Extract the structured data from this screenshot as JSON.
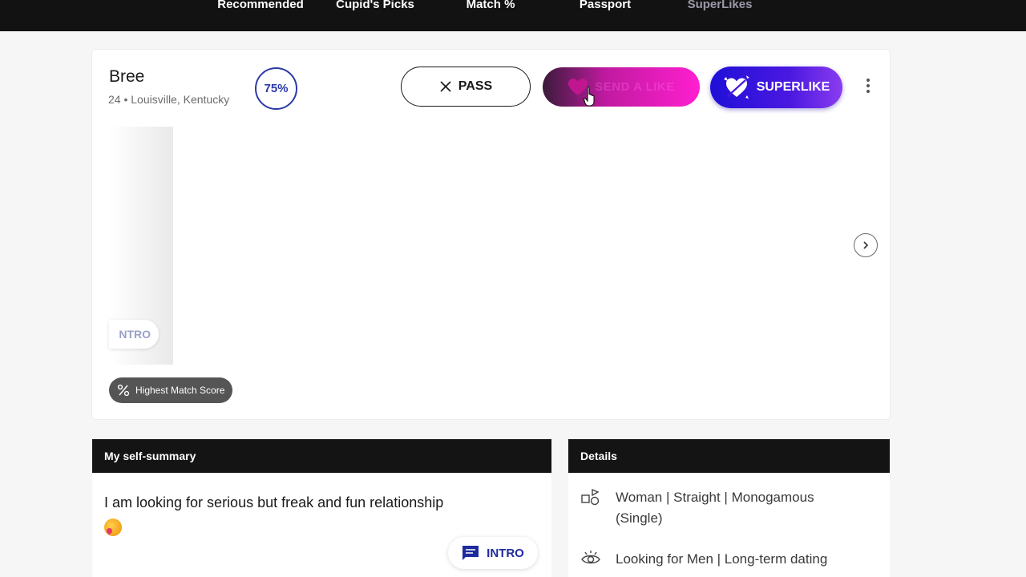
{
  "nav": {
    "tabs": [
      {
        "label": "Recommended",
        "active": false
      },
      {
        "label": "Cupid's Picks",
        "active": false
      },
      {
        "label": "Match %",
        "active": true
      },
      {
        "label": "Passport",
        "active": false
      },
      {
        "label": "SuperLikes",
        "active": false
      }
    ]
  },
  "profile": {
    "name": "Bree",
    "meta": "24 • Louisville, Kentucky",
    "match_percent": "75%",
    "photo_intro_label": "NTRO",
    "badge_label": "Highest Match Score"
  },
  "actions": {
    "pass_label": "PASS",
    "like_label": "SEND A LIKE",
    "superlike_label": "SUPERLIKE"
  },
  "summary": {
    "header": "My self-summary",
    "text": "I am looking for serious but freak and fun relationship",
    "intro_label": "INTRO"
  },
  "details": {
    "header": "Details",
    "rows": [
      {
        "icon": "gender-shapes-icon",
        "text": "Woman | Straight | Monogamous (Single)"
      },
      {
        "icon": "eye-icon",
        "text": "Looking for Men | Long-term dating"
      }
    ]
  },
  "colors": {
    "nav_bg": "#121212",
    "accent_blue": "#2b3aa6",
    "superlike": "#1f10d8",
    "like_pink": "#ff1fd0"
  }
}
